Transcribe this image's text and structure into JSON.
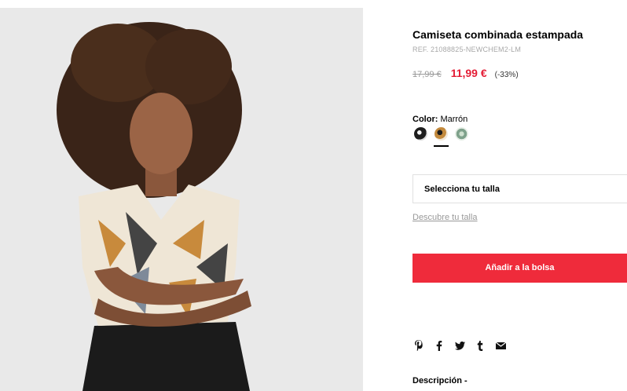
{
  "product": {
    "title": "Camiseta combinada estampada",
    "ref": "REF. 21088825-NEWCHEM2-LM",
    "old_price": "17,99 €",
    "price": "11,99 €",
    "discount": "(-33%)"
  },
  "color": {
    "label": "Color:",
    "value": "Marrón",
    "swatches": [
      "black-white-swatch",
      "brown-swatch",
      "green-swatch"
    ],
    "selected_index": 1
  },
  "size": {
    "select_label": "Selecciona tu talla",
    "guide_link": "Descubre tu talla"
  },
  "actions": {
    "add_to_bag": "Añadir a la bolsa"
  },
  "share": {
    "icons": [
      "pinterest-icon",
      "facebook-icon",
      "twitter-icon",
      "tumblr-icon",
      "email-icon"
    ]
  },
  "description": {
    "label": "Descripción -"
  },
  "colors": {
    "accent": "#ef2b3b",
    "sale": "#e41d36",
    "muted": "#999999"
  }
}
